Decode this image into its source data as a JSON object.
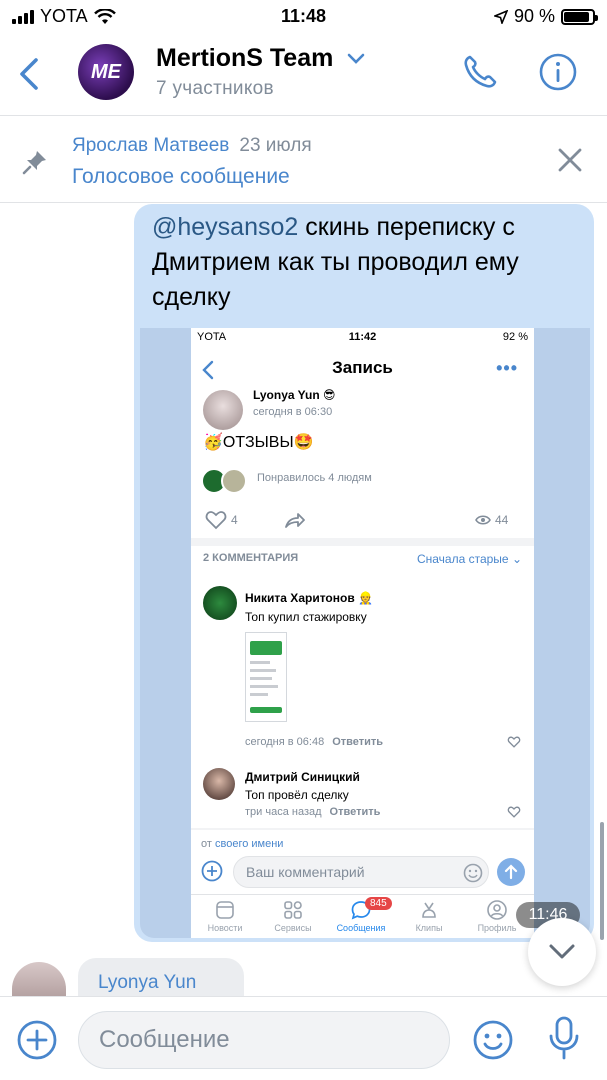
{
  "status_bar": {
    "carrier": "YOTA",
    "time": "11:48",
    "battery": "90 %",
    "battery_level": 0.9
  },
  "header": {
    "title": "MertionS Team",
    "subtitle": "7 участников",
    "avatar_text": "ME"
  },
  "pinned": {
    "author": "Ярослав Матвеев",
    "date": "23 июля",
    "text": "Голосовое сообщение"
  },
  "message": {
    "mention": "@heysanso2",
    "text": " скинь переписку с Дмитрием как ты проводил ему сделку",
    "time": "11:46"
  },
  "screenshot": {
    "status": {
      "carrier": "YOTA",
      "time": "11:42",
      "battery": "92 %"
    },
    "title": "Запись",
    "more": "•••",
    "post": {
      "author": "Lyonya Yun 😎",
      "time": "сегодня в 06:30",
      "text": "🥳ОТЗЫВЫ🤩",
      "likes_text": "Понравилось 4 людям",
      "likes": "4",
      "views": "44"
    },
    "comments_count": "2 КОММЕНТАРИЯ",
    "sort": "Сначала старые",
    "comments": [
      {
        "name": "Никита Харитонов 👷",
        "text": "Топ купил стажировку",
        "meta": "сегодня в 06:48",
        "reply": "Ответить"
      },
      {
        "name": "Дмитрий Синицкий",
        "text": "Топ провёл сделку",
        "meta": "три часа назад",
        "reply": "Ответить"
      }
    ],
    "from_prefix": "от",
    "from_link": "своего имени",
    "input_placeholder": "Ваш комментарий",
    "tabs": [
      {
        "label": "Новости"
      },
      {
        "label": "Сервисы"
      },
      {
        "label": "Сообщения",
        "badge": "845"
      },
      {
        "label": "Клипы"
      },
      {
        "label": "Профиль"
      }
    ]
  },
  "next_message": {
    "author": "Lyonya Yun"
  },
  "composer": {
    "placeholder": "Сообщение"
  },
  "colors": {
    "accent": "#4986cc",
    "bubble_out": "#cce1f8",
    "bubble_in": "#ebedf0"
  }
}
